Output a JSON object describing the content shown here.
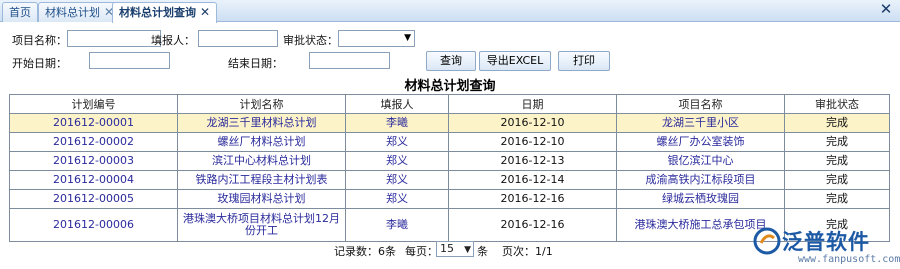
{
  "tabs": [
    {
      "label": "首页",
      "closable": false
    },
    {
      "label": "材料总计划",
      "closable": true
    },
    {
      "label": "材料总计划查询",
      "closable": true,
      "active": true
    }
  ],
  "form": {
    "project_name_label": "项目名称：",
    "project_name_value": "",
    "filler_label": "填报人：",
    "filler_value": "",
    "approval_label": "审批状态：",
    "approval_value": "",
    "start_date_label": "开始日期：",
    "start_date_value": "",
    "end_date_label": "结束日期：",
    "end_date_value": "",
    "query_button": "查询",
    "export_button": "导出EXCEL",
    "print_button": "打印"
  },
  "page_title": "材料总计划查询",
  "table": {
    "headers": [
      "计划编号",
      "计划名称",
      "填报人",
      "日期",
      "项目名称",
      "审批状态"
    ],
    "rows": [
      [
        "201612-00001",
        "龙湖三千里材料总计划",
        "李曦",
        "2016-12-10",
        "龙湖三千里小区",
        "完成"
      ],
      [
        "201612-00002",
        "螺丝厂材料总计划",
        "郑义",
        "2016-12-10",
        "螺丝厂办公室装饰",
        "完成"
      ],
      [
        "201612-00003",
        "滨江中心材料总计划",
        "郑义",
        "2016-12-13",
        "银亿滨江中心",
        "完成"
      ],
      [
        "201612-00004",
        "铁路内江工程段主材计划表",
        "郑义",
        "2016-12-14",
        "成渝高铁内江标段项目",
        "完成"
      ],
      [
        "201612-00005",
        "玫瑰园材料总计划",
        "郑义",
        "2016-12-16",
        "绿城云栖玫瑰园",
        "完成"
      ],
      [
        "201612-00006",
        "港珠澳大桥项目材料总计划12月份开工",
        "李曦",
        "2016-12-16",
        "港珠澳大桥施工总承包项目",
        "完成"
      ]
    ]
  },
  "pager": {
    "records_label": "记录数：6条",
    "per_page_label": "每页：",
    "per_page_value": "15",
    "per_page_unit": "条",
    "page_label": "页次：1/1"
  },
  "logo": {
    "name": "泛普软件",
    "url": "www.fanpusoft.com"
  },
  "colors": {
    "tab_bar": "#cddff3",
    "link": "#2a2a9c",
    "highlight_row": "#fcf3c9",
    "logo_blue": "#1d5aa6"
  }
}
